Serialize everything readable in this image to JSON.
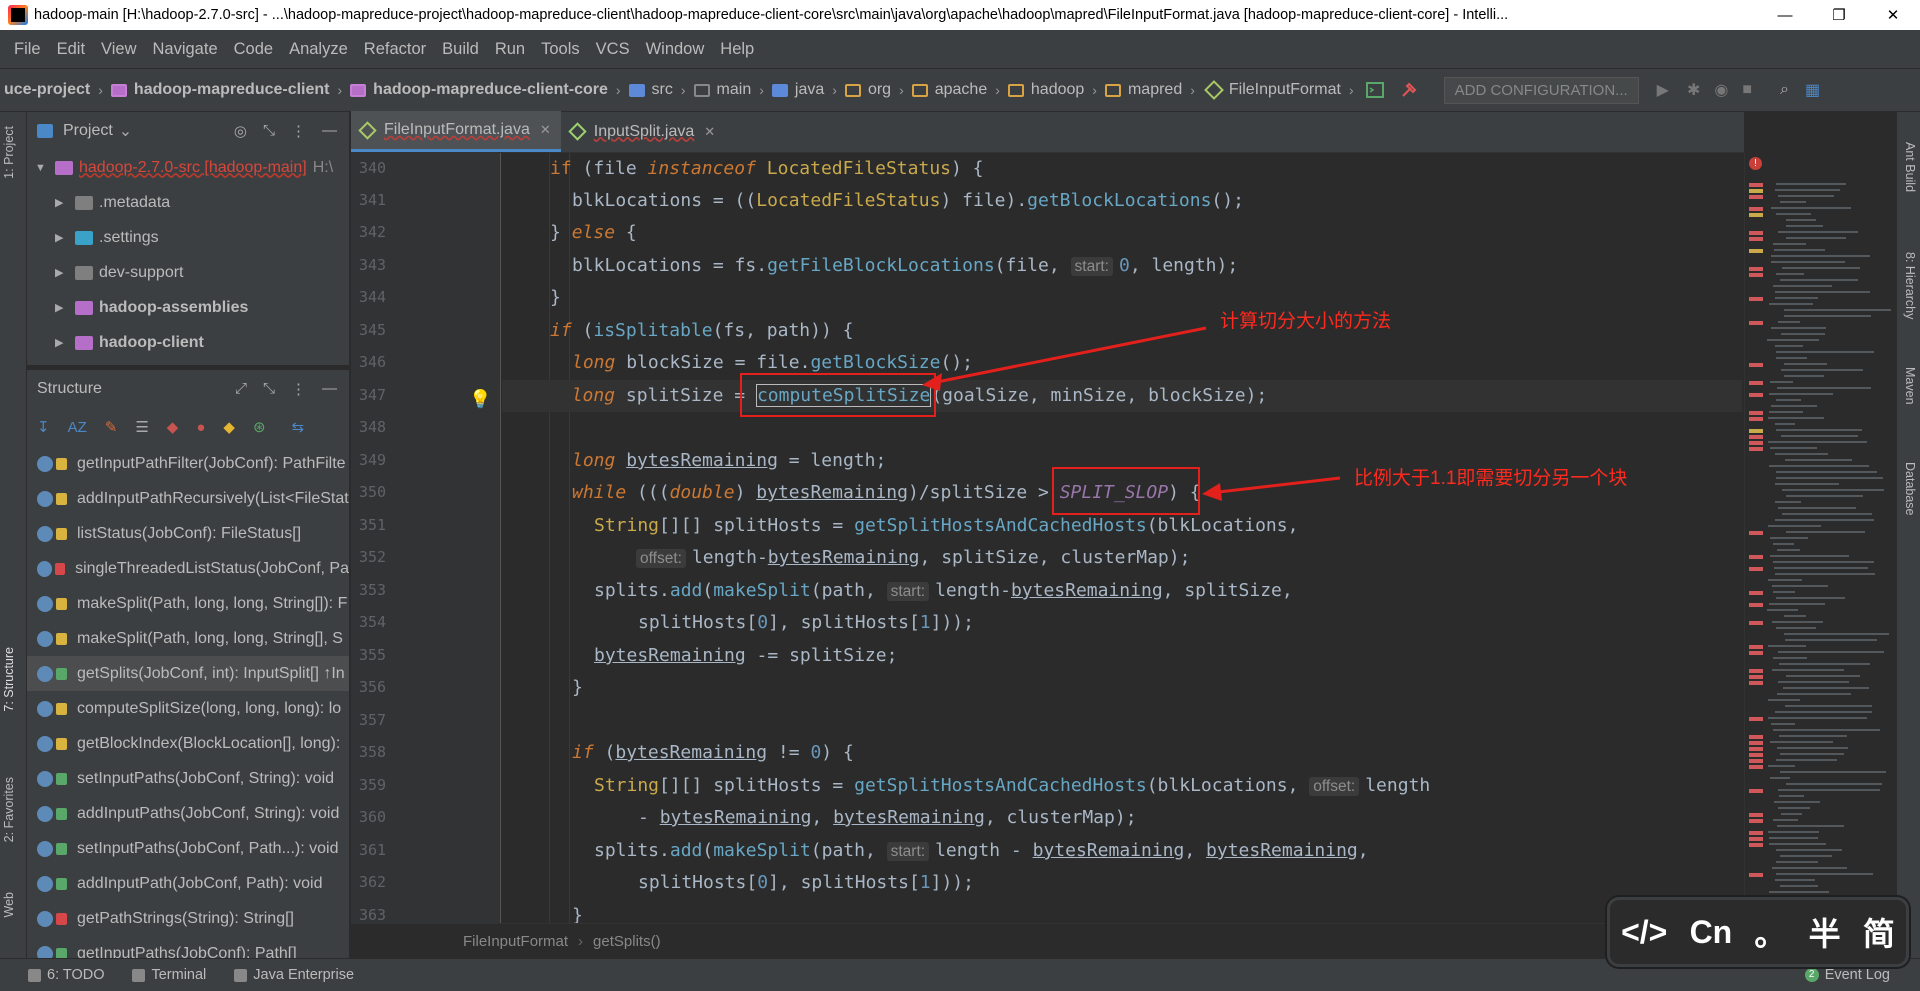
{
  "window": {
    "title": "hadoop-main [H:\\hadoop-2.7.0-src] - ...\\hadoop-mapreduce-project\\hadoop-mapreduce-client\\hadoop-mapreduce-client-core\\src\\main\\java\\org\\apache\\hadoop\\mapred\\FileInputFormat.java [hadoop-mapreduce-client-core] - Intelli...",
    "minimize": "—",
    "maximize": "❐",
    "close": "✕"
  },
  "menu": [
    "File",
    "Edit",
    "View",
    "Navigate",
    "Code",
    "Analyze",
    "Refactor",
    "Build",
    "Run",
    "Tools",
    "VCS",
    "Window",
    "Help"
  ],
  "navbar": {
    "crumbs": [
      "uce-project",
      "hadoop-mapreduce-client",
      "hadoop-mapreduce-client-core",
      "src",
      "main",
      "java",
      "org",
      "apache",
      "hadoop",
      "mapred",
      "FileInputFormat"
    ],
    "add_config": "ADD CONFIGURATION..."
  },
  "left_tabs": {
    "project": "1: Project",
    "structure": "7: Structure",
    "favorites": "2: Favorites",
    "web": "Web"
  },
  "right_tabs": {
    "ant": "Ant Build",
    "hierarchy": "8: Hierarchy",
    "maven": "Maven",
    "database": "Database"
  },
  "project_panel": {
    "title": "Project",
    "items": [
      {
        "label": "hadoop-2.7.0-src [hadoop-main]",
        "suffix": "H:\\",
        "expanded": true
      },
      {
        "label": ".metadata"
      },
      {
        "label": ".settings"
      },
      {
        "label": "dev-support"
      },
      {
        "label": "hadoop-assemblies"
      },
      {
        "label": "hadoop-client"
      }
    ]
  },
  "structure_panel": {
    "title": "Structure",
    "items": [
      "getInputPathFilter(JobConf): PathFilte",
      "addInputPathRecursively(List<FileStat",
      "listStatus(JobConf): FileStatus[]",
      "singleThreadedListStatus(JobConf, Pa",
      "makeSplit(Path, long, long, String[]): F",
      "makeSplit(Path, long, long, String[], S",
      "getSplits(JobConf, int): InputSplit[] ↑In",
      "computeSplitSize(long, long, long): lo",
      "getBlockIndex(BlockLocation[], long):",
      "setInputPaths(JobConf, String): void",
      "addInputPaths(JobConf, String): void",
      "setInputPaths(JobConf, Path...): void",
      "addInputPath(JobConf, Path): void",
      "getPathStrings(String): String[]",
      "getInputPaths(JobConf): Path[]"
    ]
  },
  "tabs": [
    {
      "label": "FileInputFormat.java",
      "active": true
    },
    {
      "label": "InputSplit.java",
      "active": false
    }
  ],
  "code": {
    "line_numbers": [
      "340",
      "341",
      "342",
      "343",
      "344",
      "345",
      "346",
      "347",
      "348",
      "349",
      "350",
      "351",
      "352",
      "353",
      "354",
      "355",
      "356",
      "357",
      "358",
      "359",
      "360",
      "361",
      "362",
      "363"
    ]
  },
  "annotations": {
    "compute_note": "计算切分大小的方法",
    "slop_note": "比例大于1.1即需要切分另一个块"
  },
  "editor_breadcrumb": [
    "FileInputFormat",
    "getSplits()"
  ],
  "bottom": {
    "todo": "6: TODO",
    "terminal": "Terminal",
    "java_enterprise": "Java Enterprise",
    "event_log": "Event Log",
    "event_count": "2"
  },
  "ime_badge": {
    "code": "</>",
    "cn": "Cn",
    "dot": "。",
    "half": "半",
    "simp": "简"
  }
}
